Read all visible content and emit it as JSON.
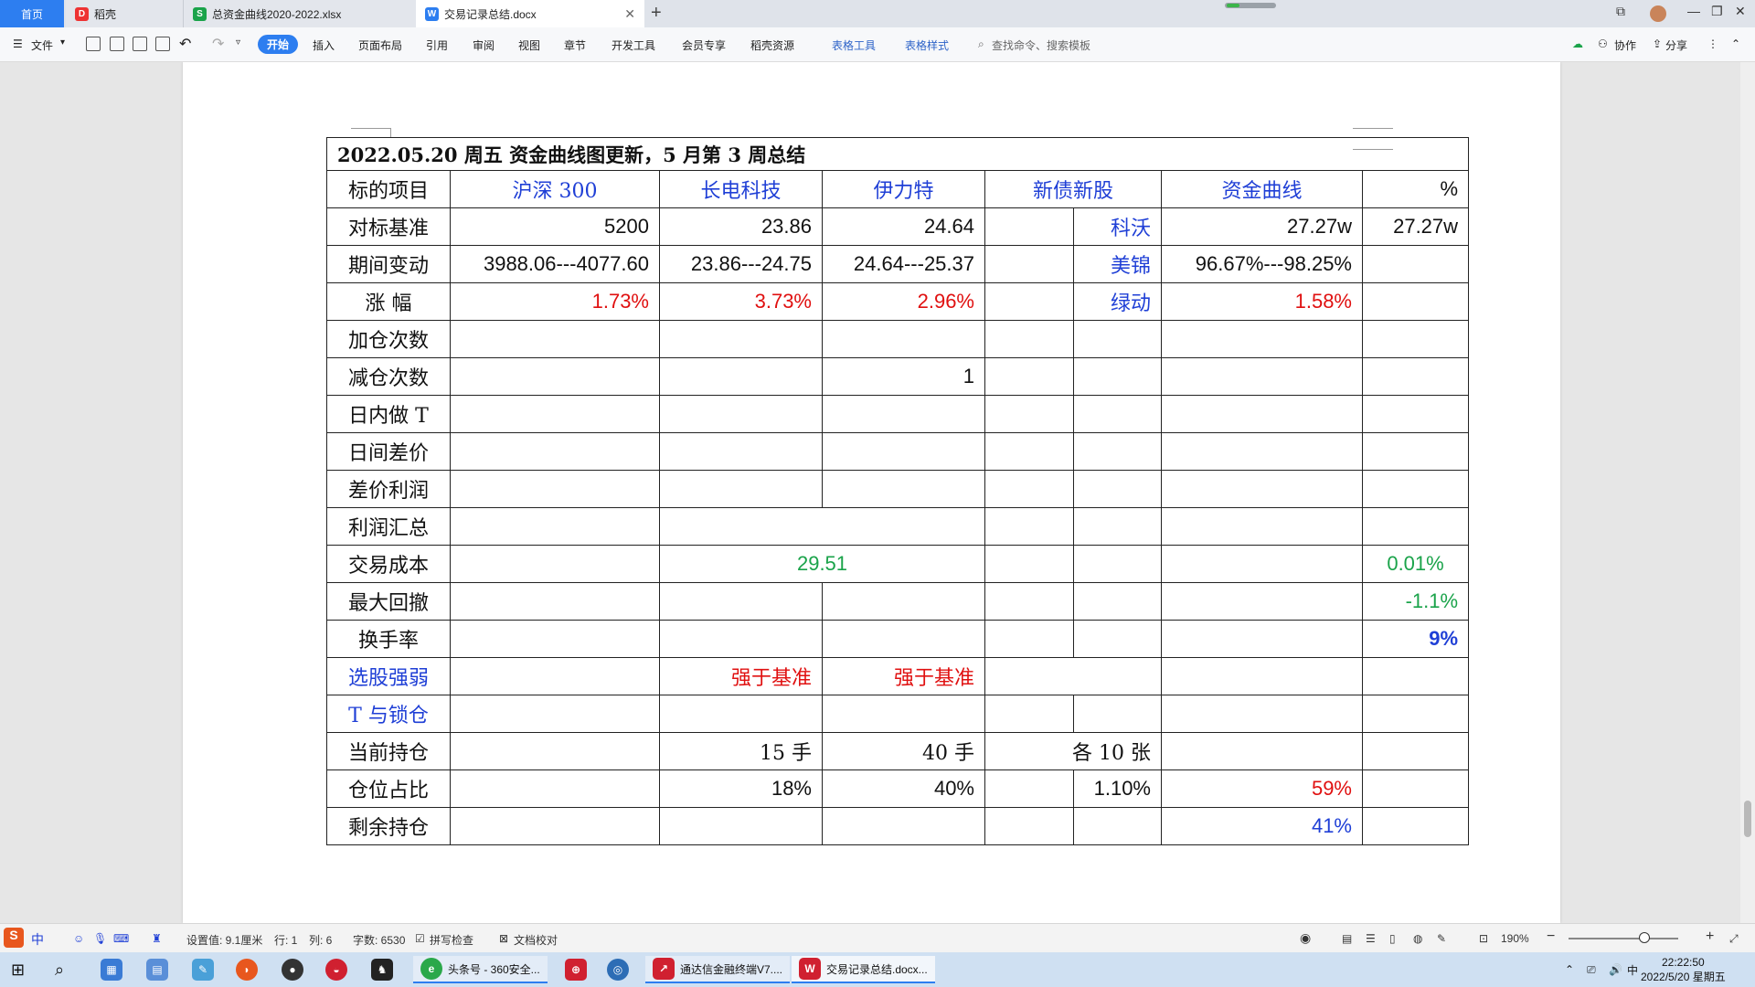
{
  "tabs": {
    "home": "首页",
    "t1": "稻壳",
    "t2": "总资金曲线2020-2022.xlsx",
    "t3": "交易记录总结.docx",
    "add": "+"
  },
  "ribbon": {
    "file": "文件",
    "items": [
      "开始",
      "插入",
      "页面布局",
      "引用",
      "审阅",
      "视图",
      "章节",
      "开发工具",
      "会员专享",
      "稻壳资源"
    ],
    "table_tools": "表格工具",
    "table_style": "表格样式",
    "search_placeholder": "查找命令、搜索模板",
    "collab": "协作",
    "share": "分享"
  },
  "table": {
    "title": "2022.05.20  周五  资金曲线图更新，5 月第 3 周总结",
    "header": [
      "标的项目",
      "沪深 300",
      "长电科技",
      "伊力特",
      "新债新股",
      "资金曲线",
      "%"
    ],
    "row_benchmark": {
      "label": "对标基准",
      "hs300": "5200",
      "cd": "23.86",
      "ylt": "24.64",
      "name": "科沃",
      "fund": "27.27w",
      "pct": "27.27w"
    },
    "row_change": {
      "label": "期间变动",
      "hs300": "3988.06---4077.60",
      "cd": "23.86---24.75",
      "ylt": "24.64---25.37",
      "name": "美锦",
      "fund": "96.67%---98.25%"
    },
    "row_rise": {
      "label": "涨  幅",
      "hs300": "1.73%",
      "cd": "3.73%",
      "ylt": "2.96%",
      "name": "绿动",
      "fund": "1.58%"
    },
    "row_add": {
      "label": "加仓次数"
    },
    "row_reduce": {
      "label": "减仓次数",
      "ylt": "1"
    },
    "row_t": {
      "label": "日内做 T"
    },
    "row_diff": {
      "label": "日间差价"
    },
    "row_profit": {
      "label": "差价利润"
    },
    "row_profit_total": {
      "label": "利润汇总"
    },
    "row_cost": {
      "label": "交易成本",
      "cd_ylt": "29.51",
      "pct": "0.01%"
    },
    "row_drawdown": {
      "label": "最大回撤",
      "pct": "-1.1%"
    },
    "row_turnover": {
      "label": "换手率",
      "pct": "9%"
    },
    "row_strength": {
      "label": "选股强弱",
      "cd": "强于基准",
      "ylt": "强于基准"
    },
    "row_lock": {
      "label": "T 与锁仓"
    },
    "row_hold": {
      "label": "当前持仓",
      "cd": "15 手",
      "ylt": "40 手",
      "bond": "各 10 张"
    },
    "row_ratio": {
      "label": "仓位占比",
      "cd": "18%",
      "ylt": "40%",
      "bond": "1.10%",
      "fund": "59%"
    },
    "row_remain": {
      "label": "剩余持仓",
      "fund": "41%"
    }
  },
  "status": {
    "setting": "设置值: 9.1厘米",
    "row": "行: 1",
    "col": "列: 6",
    "words": "字数: 6530",
    "spell": "拼写检查",
    "proof": "文档校对",
    "zoom": "190%",
    "ime": "中"
  },
  "taskbar": {
    "app1": "头条号 - 360安全...",
    "app2": "通达信金融终端V7....",
    "app3": "交易记录总结.docx...",
    "time": "22:22:50",
    "date": "2022/5/20 星期五"
  },
  "colors": {
    "accent": "#2d7ef0",
    "blue_text": "#1f3fd6",
    "red_text": "#e01010",
    "green_text": "#1aa34a"
  }
}
